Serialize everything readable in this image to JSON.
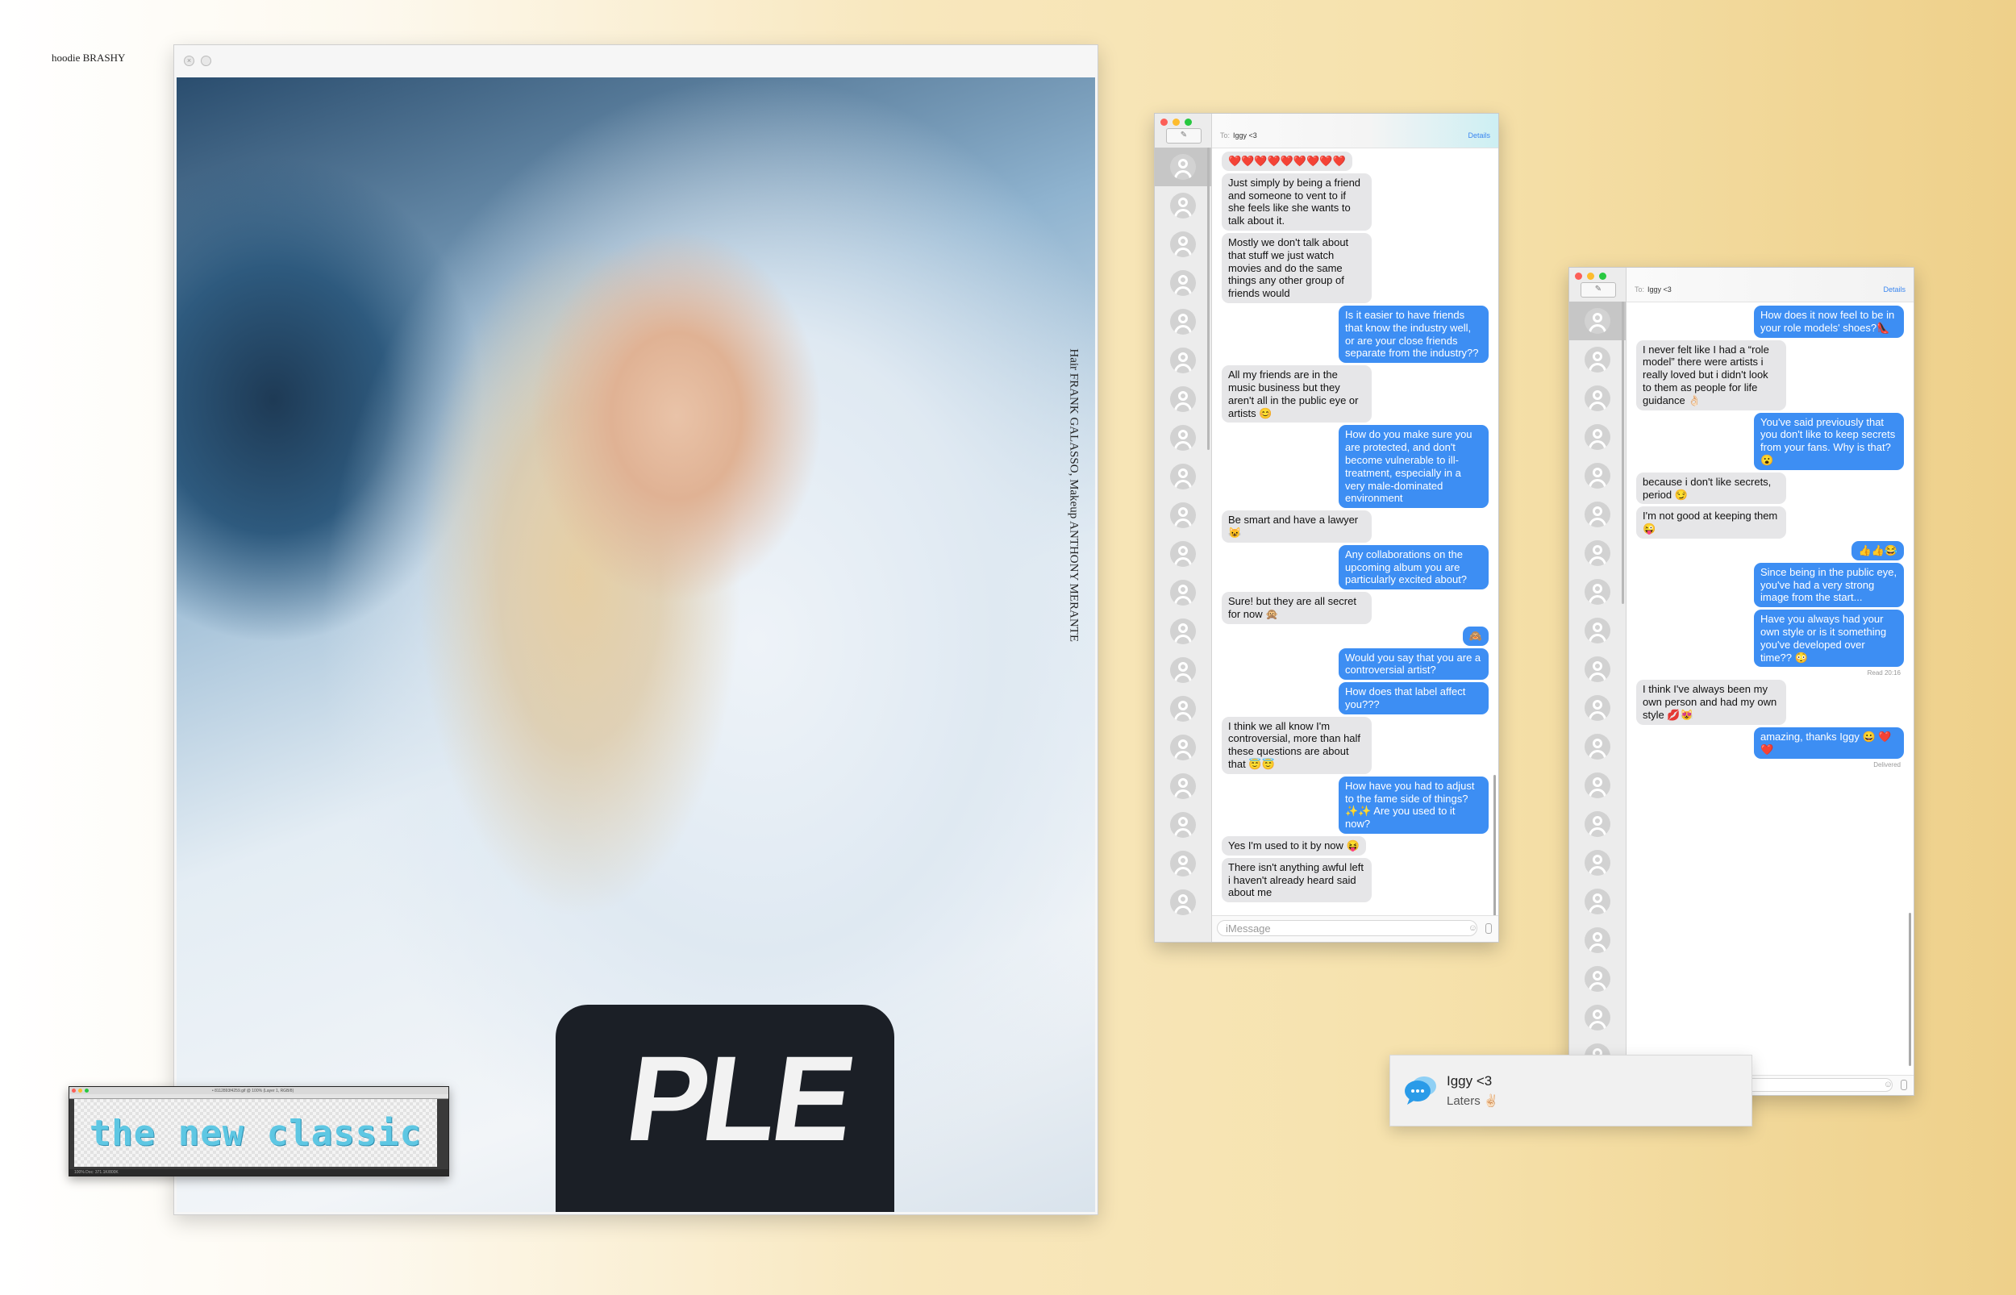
{
  "page": {
    "caption": "hoodie BRASHY"
  },
  "viewer": {
    "credit": "Hair FRANK GALASSO, Makeup ANTHONY MERANTE",
    "shirt_text": "PLE"
  },
  "psd": {
    "title": "• 8112893f4259.gif @ 100% (Layer 1, RGB/8)",
    "canvas_text": "the new classic",
    "status": "100%   Doc: 371.1K/800K"
  },
  "messages1": {
    "to_label": "To:",
    "to": "Iggy <3",
    "details": "Details",
    "input_placeholder": "iMessage",
    "thread": [
      {
        "from": "them",
        "text": "❤️❤️❤️❤️❤️❤️❤️❤️❤️"
      },
      {
        "from": "them",
        "text": "Just simply by being a friend and someone to vent to if she feels like she wants to talk about it."
      },
      {
        "from": "them",
        "text": "Mostly we don't talk about that stuff we just watch movies and do the same things any other group of friends would"
      },
      {
        "from": "me",
        "text": "Is it easier to have friends that know the industry well, or are your close friends separate from the industry??"
      },
      {
        "from": "them",
        "text": "All my friends are in the music business but they aren't all in the public eye or artists 😊"
      },
      {
        "from": "me",
        "text": "How do you make sure you are protected, and don't become vulnerable to ill-treatment, especially in a very male-dominated environment"
      },
      {
        "from": "them",
        "text": "Be smart and have a lawyer 😺"
      },
      {
        "from": "me",
        "text": "Any collaborations on the upcoming album you are particularly excited about?"
      },
      {
        "from": "them",
        "text": "Sure! but they are all secret for now 🙊"
      },
      {
        "from": "me",
        "text": "🙈"
      },
      {
        "from": "me",
        "text": "Would you say that you are a controversial artist?"
      },
      {
        "from": "me",
        "text": "How does that label affect you???"
      },
      {
        "from": "them",
        "text": "I think we all know I'm controversial, more than half these questions are about that 😇😇"
      },
      {
        "from": "me",
        "text": "How have you had to adjust to the fame side of things? ✨✨ Are you used to it now?"
      },
      {
        "from": "them",
        "text": "Yes I'm used to it by now 😝"
      },
      {
        "from": "them",
        "text": "There isn't anything awful left i haven't already heard said about me"
      }
    ]
  },
  "messages2": {
    "to_label": "To:",
    "to": "Iggy <3",
    "details": "Details",
    "read_receipt": "Read 20:16",
    "delivered": "Delivered",
    "thread": [
      {
        "from": "me",
        "text": "How does it now feel to be in your role models' shoes?👠"
      },
      {
        "from": "them",
        "text": "I never felt like I had a “role model” there were artists i really loved but i didn't look to them as people for life guidance 👌🏻"
      },
      {
        "from": "me",
        "text": "You've said previously that you don't like to keep secrets from your fans. Why is that? 😮"
      },
      {
        "from": "them",
        "text": "because i don't like secrets, period 😏"
      },
      {
        "from": "them",
        "text": "I'm not good at keeping them 😜"
      },
      {
        "from": "me",
        "text": "👍👍😂"
      },
      {
        "from": "me",
        "text": "Since being in the public eye, you've had a very strong image from the start..."
      },
      {
        "from": "me",
        "text": "Have you always had your own style or is it something you've developed over time?? 😳",
        "meta": "read"
      },
      {
        "from": "them",
        "text": "I think I've always been my own person and had my own style 💋😻"
      },
      {
        "from": "me",
        "text": "amazing, thanks Iggy 😀 ❤️❤️",
        "meta": "delivered"
      }
    ]
  },
  "notification": {
    "title": "Iggy <3",
    "body": "Laters ✌🏻"
  },
  "colors": {
    "bubble_me": "#3d8ef3",
    "bubble_them": "#e6e6e8",
    "details": "#3a86f0"
  },
  "icons": {
    "notification": "messages-bubble-icon",
    "compose": "compose-icon"
  }
}
